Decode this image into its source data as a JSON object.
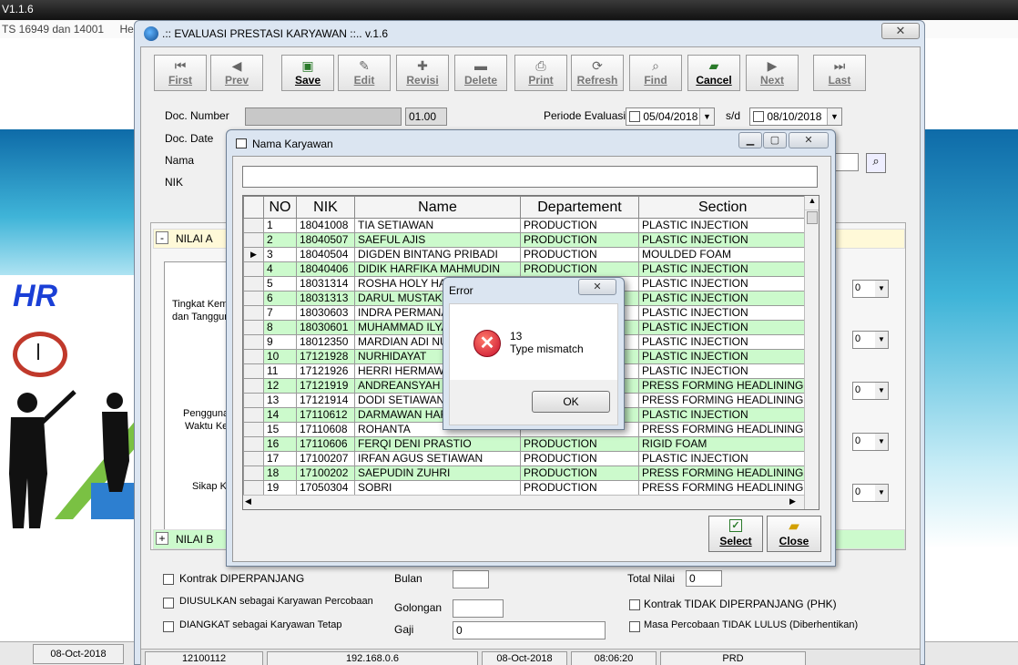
{
  "background_app": {
    "title": "V1.1.6",
    "menu": [
      "TS 16949 dan 14001",
      "Help"
    ],
    "logo_text": "HR",
    "status": [
      "08-Oct-2018"
    ]
  },
  "main_window": {
    "title": ".:: EVALUASI PRESTASI KARYAWAN ::.. v.1.6",
    "close": "✕",
    "toolbar": [
      {
        "label": "First",
        "icon": "first-icon",
        "enabled": false
      },
      {
        "label": "Prev",
        "icon": "prev-icon",
        "enabled": false
      },
      {
        "label": "Save",
        "icon": "save-icon",
        "enabled": true
      },
      {
        "label": "Edit",
        "icon": "edit-icon",
        "enabled": false
      },
      {
        "label": "Revisi",
        "icon": "revisi-icon",
        "enabled": false
      },
      {
        "label": "Delete",
        "icon": "delete-icon",
        "enabled": false
      },
      {
        "label": "Print",
        "icon": "print-icon",
        "enabled": false
      },
      {
        "label": "Refresh",
        "icon": "refresh-icon",
        "enabled": false
      },
      {
        "label": "Find",
        "icon": "find-icon",
        "enabled": false
      },
      {
        "label": "Cancel",
        "icon": "cancel-icon",
        "enabled": true
      },
      {
        "label": "Next",
        "icon": "next-icon",
        "enabled": false
      },
      {
        "label": "Last",
        "icon": "last-icon",
        "enabled": false
      }
    ],
    "form": {
      "doc_number_label": "Doc. Number",
      "doc_number_suffix": "01.00",
      "doc_date_label": "Doc. Date",
      "nama_label": "Nama",
      "nik_label": "NIK",
      "periode_label": "Periode Evaluasi",
      "periode_from": "05/04/2018",
      "periode_sd": "s/d",
      "periode_to": "08/10/2018"
    },
    "sections": {
      "nilai_a": "NILAI A",
      "nilai_b": "NILAI B",
      "nilai_a_toggle": "-",
      "nilai_b_toggle": "+"
    },
    "criteria": [
      "Tingkat Kem",
      "dan Tanggun",
      "Pengguna",
      "Waktu Ke",
      "Sikap Ke"
    ],
    "bottom": {
      "kontrak_diperpanjang": "Kontrak DIPERPANJANG",
      "diusulkan": "DIUSULKAN sebagai Karyawan Percobaan",
      "diangkat": "DIANGKAT sebagai Karyawan Tetap",
      "bulan": "Bulan",
      "golongan": "Golongan",
      "gaji": "Gaji",
      "gaji_value": "0",
      "total_nilai": "Total Nilai",
      "total_value": "0",
      "kontrak_tidak": "Kontrak TIDAK DIPERPANJANG (PHK)",
      "masa_percobaan": "Masa Percobaan TIDAK LULUS (Diberhentikan)"
    },
    "statusbar": [
      "12100112",
      "192.168.0.6",
      "08-Oct-2018",
      "08:06:20",
      "PRD"
    ]
  },
  "dialog": {
    "title": "Nama Karyawan",
    "columns": [
      "NO",
      "NIK",
      "Name",
      "Departement",
      "Section"
    ],
    "rows": [
      [
        "1",
        "18041008",
        "TIA SETIAWAN",
        "PRODUCTION",
        "PLASTIC INJECTION"
      ],
      [
        "2",
        "18040507",
        "SAEFUL AJIS",
        "PRODUCTION",
        "PLASTIC INJECTION"
      ],
      [
        "3",
        "18040504",
        "DIGDEN BINTANG PRIBADI",
        "PRODUCTION",
        "MOULDED FOAM"
      ],
      [
        "4",
        "18040406",
        "DIDIK HARFIKA MAHMUDIN",
        "PRODUCTION",
        "PLASTIC INJECTION"
      ],
      [
        "5",
        "18031314",
        "ROSHA HOLY HAM",
        "",
        "PLASTIC INJECTION"
      ],
      [
        "6",
        "18031313",
        "DARUL MUSTAKIM",
        "",
        "PLASTIC INJECTION"
      ],
      [
        "7",
        "18030603",
        "INDRA PERMANA",
        "",
        "PLASTIC INJECTION"
      ],
      [
        "8",
        "18030601",
        "MUHAMMAD ILYA",
        "",
        "PLASTIC INJECTION"
      ],
      [
        "9",
        "18012350",
        "MARDIAN ADI NU",
        "",
        "PLASTIC INJECTION"
      ],
      [
        "10",
        "17121928",
        "NURHIDAYAT",
        "",
        "PLASTIC INJECTION"
      ],
      [
        "11",
        "17121926",
        "HERRI HERMAWA",
        "",
        "PLASTIC INJECTION"
      ],
      [
        "12",
        "17121919",
        "ANDREANSYAH",
        "",
        "PRESS FORMING HEADLINING"
      ],
      [
        "13",
        "17121914",
        "DODI SETIAWAN",
        "",
        "PRESS FORMING HEADLINING"
      ],
      [
        "14",
        "17110612",
        "DARMAWAN HAR",
        "",
        "PLASTIC INJECTION"
      ],
      [
        "15",
        "17110608",
        "ROHANTA",
        "",
        "PRESS FORMING HEADLINING"
      ],
      [
        "16",
        "17110606",
        "FERQI DENI PRASTIO",
        "PRODUCTION",
        "RIGID FOAM"
      ],
      [
        "17",
        "17100207",
        "IRFAN AGUS SETIAWAN",
        "PRODUCTION",
        "PLASTIC INJECTION"
      ],
      [
        "18",
        "17100202",
        "SAEPUDIN ZUHRI",
        "PRODUCTION",
        "PRESS FORMING HEADLINING"
      ],
      [
        "19",
        "17050304",
        "SOBRI",
        "PRODUCTION",
        "PRESS FORMING HEADLINING"
      ]
    ],
    "selected_row": 3,
    "select_label": "Select",
    "close_label": "Close"
  },
  "error_dialog": {
    "title": "Error",
    "code": "13",
    "message": "Type mismatch",
    "ok": "OK"
  }
}
